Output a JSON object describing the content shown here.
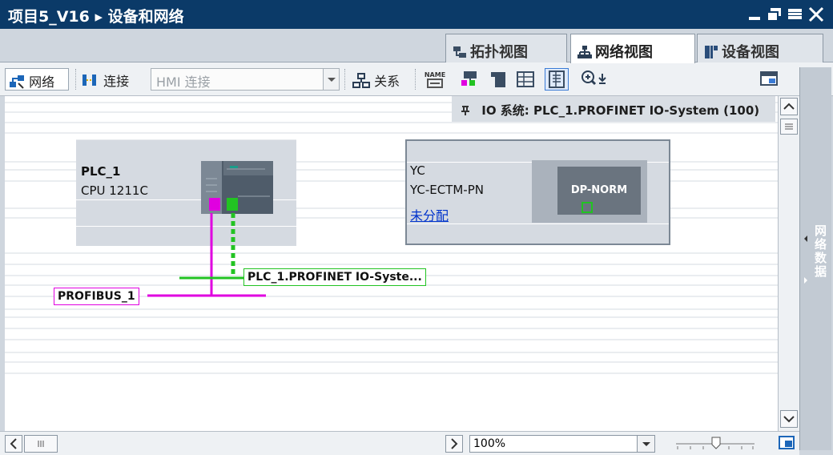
{
  "window": {
    "title": "项目5_V16 ▸ 设备和网络"
  },
  "tabs": [
    {
      "label": "拓扑视图",
      "icon": "topology-view-icon",
      "active": false
    },
    {
      "label": "网络视图",
      "icon": "network-view-icon",
      "active": true
    },
    {
      "label": "设备视图",
      "icon": "device-view-icon",
      "active": false
    }
  ],
  "toolbar": {
    "network_label": "网络",
    "connect_label": "连接",
    "connection_type": "HMI 连接",
    "relation_label": "关系",
    "name_icon_text": "NAME"
  },
  "io_system": {
    "label": "IO 系统: PLC_1.PROFINET IO-System (100)"
  },
  "devices": {
    "plc": {
      "name": "PLC_1",
      "type": "CPU 1211C"
    },
    "yc": {
      "name": "YC",
      "type": "YC-ECTM-PN",
      "assignment": "未分配",
      "module": "DP-NORM"
    }
  },
  "networks": {
    "profinet": {
      "label": "PLC_1.PROFINET IO-Syste...",
      "color": "#22c322"
    },
    "profibus": {
      "label": "PROFIBUS_1",
      "color": "#e000e0"
    }
  },
  "side_panel": {
    "label": "网络数据"
  },
  "zoom": {
    "value": "100%"
  },
  "colors": {
    "title_bar": "#0b3a68",
    "accent_link": "#0033cc"
  }
}
